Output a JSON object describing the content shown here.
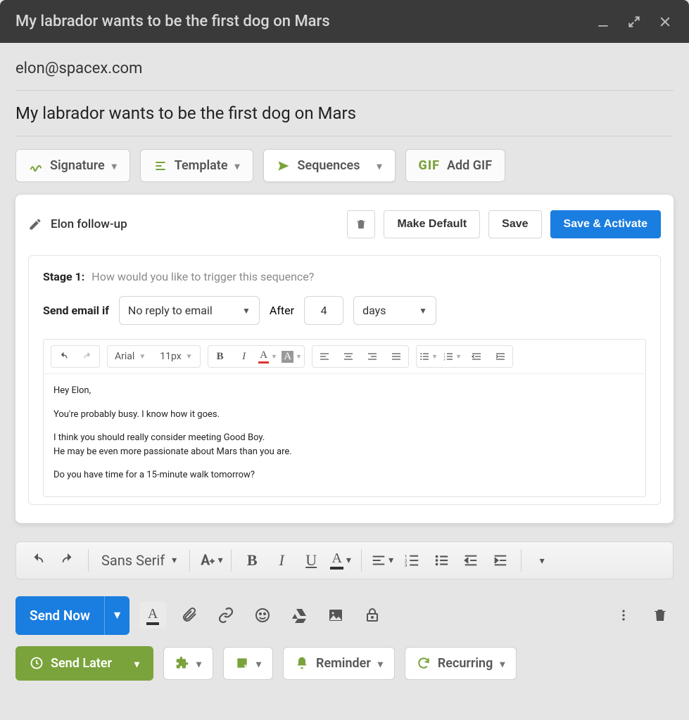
{
  "titlebar": {
    "title": "My labrador wants to be the first dog on Mars"
  },
  "to": "elon@spacex.com",
  "subject": "My labrador wants to be the first dog on Mars",
  "action_buttons": {
    "signature": "Signature",
    "template": "Template",
    "sequences": "Sequences",
    "add_gif": "Add GIF",
    "gif_prefix": "GIF"
  },
  "panel": {
    "name": "Elon follow-up",
    "make_default": "Make Default",
    "save": "Save",
    "save_activate": "Save & Activate",
    "stage_label": "Stage 1:",
    "stage_hint": "How would you like to trigger this sequence?",
    "send_if_label": "Send email if",
    "send_if_value": "No reply to email",
    "after_label": "After",
    "after_value": "4",
    "unit_value": "days",
    "editor_font": "Arial",
    "editor_size": "11px",
    "body_line1": "Hey Elon,",
    "body_line2": "You're probably busy. I know how it goes.",
    "body_line3": "I think you should really consider meeting Good Boy.",
    "body_line4": "He may be even more passionate about Mars than you are.",
    "body_line5": "Do you have time for a 15-minute walk tomorrow?"
  },
  "main_toolbar": {
    "font": "Sans Serif"
  },
  "bottom": {
    "send_now": "Send Now",
    "send_later": "Send Later",
    "reminder": "Reminder",
    "recurring": "Recurring"
  }
}
